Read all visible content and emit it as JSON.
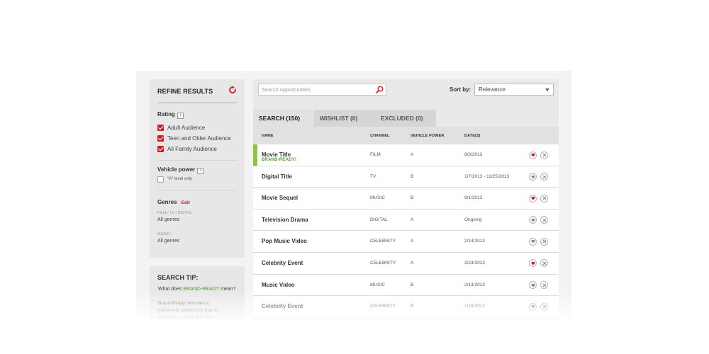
{
  "sidebar": {
    "title": "REFINE RESULTS",
    "rating": {
      "title": "Rating",
      "info": "i",
      "options": [
        {
          "label": "Adult Audience",
          "checked": true
        },
        {
          "label": "Teen and Older Audience",
          "checked": true
        },
        {
          "label": "All Family Audience",
          "checked": true
        }
      ]
    },
    "vehicle_power": {
      "title": "Vehicle power",
      "info": "i",
      "option": {
        "label": "\"A\" level only",
        "checked": false
      }
    },
    "genres": {
      "title": "Genres",
      "edit": "Edit",
      "groups": [
        {
          "label": "FILM / TV / DIGITAL:",
          "value": "All genres"
        },
        {
          "label": "MUSIC:",
          "value": "All genres"
        }
      ]
    }
  },
  "tip": {
    "title": "SEARCH TIP:",
    "question_prefix": "What does ",
    "question_highlight": "BRAND-READY",
    "question_suffix": " mean?",
    "answer": "Brand-Ready indicates a placement opportunity that is exclusive to BSN, and may"
  },
  "search": {
    "placeholder": "Search opportunities",
    "value": ""
  },
  "sort": {
    "label": "Sort by:",
    "value": "Relevance"
  },
  "tabs": [
    {
      "label": "SEARCH (150)",
      "active": true
    },
    {
      "label": "WISHLIST (0)",
      "active": false
    },
    {
      "label": "EXCLUDED (0)",
      "active": false
    }
  ],
  "columns": {
    "name": "NAME",
    "channel": "CHANNEL",
    "vehicle_power": "VEHICLE POWER",
    "dates": "DATE(S)"
  },
  "rows": [
    {
      "name": "Movie Title",
      "badge": "BRAND-READY!",
      "channel": "FILM",
      "power": "A",
      "date": "9/3/2013",
      "wishlisted": true
    },
    {
      "name": "Digital Title",
      "badge": "",
      "channel": "TV",
      "power": "B",
      "date": "1/7/2013 - 11/25/2013",
      "wishlisted": false
    },
    {
      "name": "Movie Sequel",
      "badge": "",
      "channel": "MUSIC",
      "power": "B",
      "date": "9/1/2013",
      "wishlisted": true
    },
    {
      "name": "Television Drama",
      "badge": "",
      "channel": "DIGITAL",
      "power": "A",
      "date": "Ongoing",
      "wishlisted": false
    },
    {
      "name": "Pop Music Video",
      "badge": "",
      "channel": "CELEBRITY",
      "power": "A",
      "date": "2/14/2013",
      "wishlisted": false
    },
    {
      "name": "Celebrity Event",
      "badge": "",
      "channel": "CELEBRITY",
      "power": "A",
      "date": "2/23/2013",
      "wishlisted": true
    },
    {
      "name": "Music Video",
      "badge": "",
      "channel": "MUSIC",
      "power": "B",
      "date": "2/13/2013",
      "wishlisted": false
    },
    {
      "name": "Celebrity Event",
      "badge": "",
      "channel": "CELEBRITY",
      "power": "B",
      "date": "2/16/2013",
      "wishlisted": false
    }
  ],
  "colors": {
    "accent": "#d01c25",
    "brand_ready": "#4f9a2c",
    "highlight_bar": "#8cc63f",
    "heart_off": "#8a8a8a"
  }
}
